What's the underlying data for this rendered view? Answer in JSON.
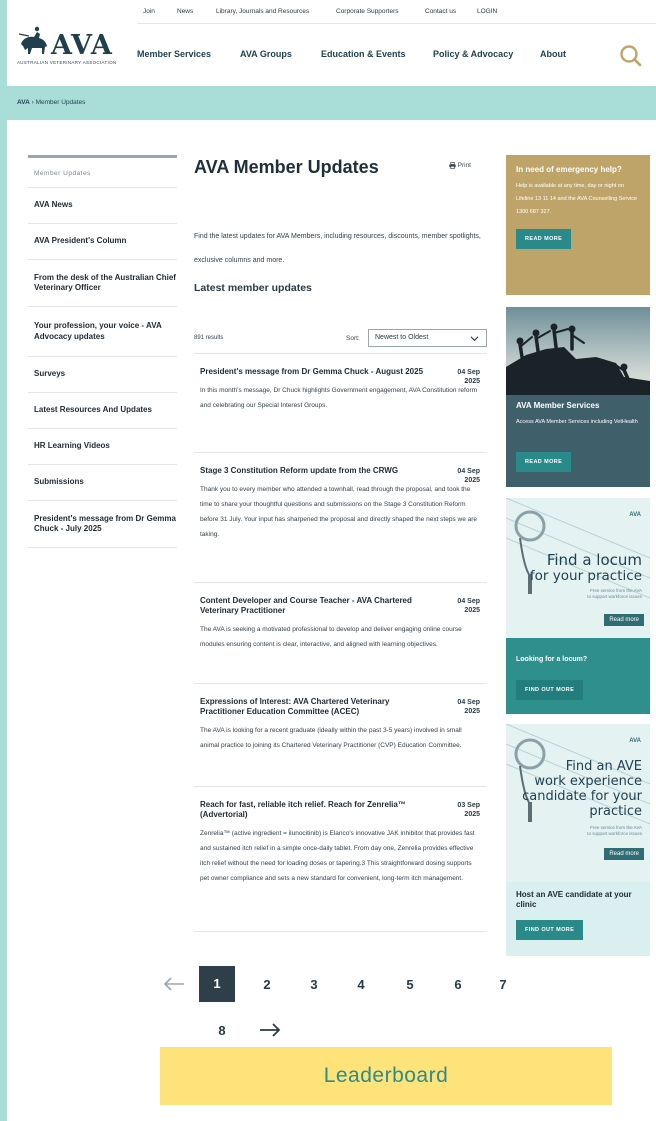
{
  "brand": {
    "name": "AVA",
    "subtitle": "AUSTRALIAN VETERINARY ASSOCIATION"
  },
  "utility_nav": [
    "Join",
    "News",
    "Library, Journals and Resources",
    "Corporate Supporters",
    "Contact us",
    "LOGIN"
  ],
  "main_nav": [
    "Member Services",
    "AVA Groups",
    "Education & Events",
    "Policy & Advocacy",
    "About"
  ],
  "breadcrumb": {
    "root": "AVA",
    "separator": "›",
    "current": "Member Updates"
  },
  "sidebar": {
    "title": "Member Updates",
    "items": [
      "AVA News",
      "AVA President's Column",
      "From the desk of the Australian Chief Veterinary Officer",
      "Your profession, your voice - AVA Advocacy updates",
      "Surveys",
      "Latest Resources And Updates",
      "HR Learning Videos",
      "Submissions",
      "President's message from Dr Gemma Chuck - July 2025"
    ]
  },
  "main": {
    "title": "AVA Member Updates",
    "print_label": "Print",
    "intro": "Find the latest updates for AVA Members, including resources, discounts, member spotlights, exclusive columns and more.",
    "subtitle": "Latest member updates",
    "results": "891 results",
    "sort_label": "Sort:",
    "sort_value": "Newest to Oldest",
    "articles": [
      {
        "title": "President's message from Dr Gemma Chuck - August 2025",
        "date": "04 Sep 2025",
        "text": "In this month's message, Dr Chuck highlights Government engagement, AVA Constitution reform and celebrating our Special Interest Groups."
      },
      {
        "title": "Stage 3 Constitution Reform update from the CRWG",
        "date": "04 Sep 2025",
        "text": "Thank you to every member who attended a townhall, read through the proposal, and took the time to share your thoughtful questions and submissions on the Stage 3 Constitution Reform before 31 July. Your input has sharpened the proposal and directly shaped the next steps we are taking."
      },
      {
        "title": "Content Developer and Course Teacher - AVA Chartered Veterinary Practitioner",
        "date": "04 Sep 2025",
        "text": "The AVA is seeking a motivated professional to develop and deliver engaging online course modules ensuring content is clear, interactive, and aligned with learning objectives."
      },
      {
        "title": "Expressions of Interest: AVA Chartered Veterinary Practitioner Education Committee (ACEC)",
        "date": "04 Sep 2025",
        "text": "The AVA is looking for a recent graduate (ideally within the past 3-5 years) involved in small animal practice to joining its Chartered Veterinary Practitioner (CVP) Education Committee."
      },
      {
        "title": "Reach for fast, reliable itch relief. Reach for Zenrelia™ (Advertorial)",
        "date": "03 Sep 2025",
        "text": "Zenrelia™ (active ingredient = ilunocitinib) is Elanco's innovative JAK inhibitor that provides fast and sustained itch relief in a simple once-daily tablet. From day one, Zenrelia provides effective itch relief without the need for loading doses or tapering.3 This straightforward dosing supports pet owner compliance and sets a new standard for convenient, long-term itch management."
      }
    ]
  },
  "rail": {
    "emergency": {
      "heading": "In need of emergency help?",
      "text": "Help is available at any time, day or night on Lifeline 13 11 14 and the AVA Counselling Service 1300 687 327.",
      "button": "READ MORE"
    },
    "member_services": {
      "heading": "AVA Member Services",
      "text": "Access AVA Member Services including VetHealth",
      "button": "READ MORE"
    },
    "locum": {
      "ad_logo": "AVA",
      "ad_line1": "Find a locum",
      "ad_line2": "for your practice",
      "ad_small1": "Free service from the AVA",
      "ad_small2": "to support workforce issues",
      "ad_button": "Read more",
      "heading": "Looking for a locum?",
      "button": "FIND OUT MORE"
    },
    "ave": {
      "ad_logo": "AVA",
      "ad_line1": "Find an AVE",
      "ad_line2": "work experience",
      "ad_line3": "candidate for your",
      "ad_line4": "practice",
      "ad_small1": "Free service from the AVA",
      "ad_small2": "to support workforce issues",
      "ad_button": "Read more",
      "heading": "Host an AVE candidate at your clinic",
      "button": "FIND OUT MORE"
    }
  },
  "pagination": {
    "current": "1",
    "pages": [
      "2",
      "3",
      "4",
      "5",
      "6",
      "7",
      "8"
    ]
  },
  "leaderboard": "Leaderboard",
  "colors": {
    "teal_light": "#a9ddd8",
    "tan": "#bfa46a",
    "teal_button": "#2a8a8a",
    "dark_navy": "#1f3f4d",
    "leaderboard_yellow": "#fde37a"
  }
}
